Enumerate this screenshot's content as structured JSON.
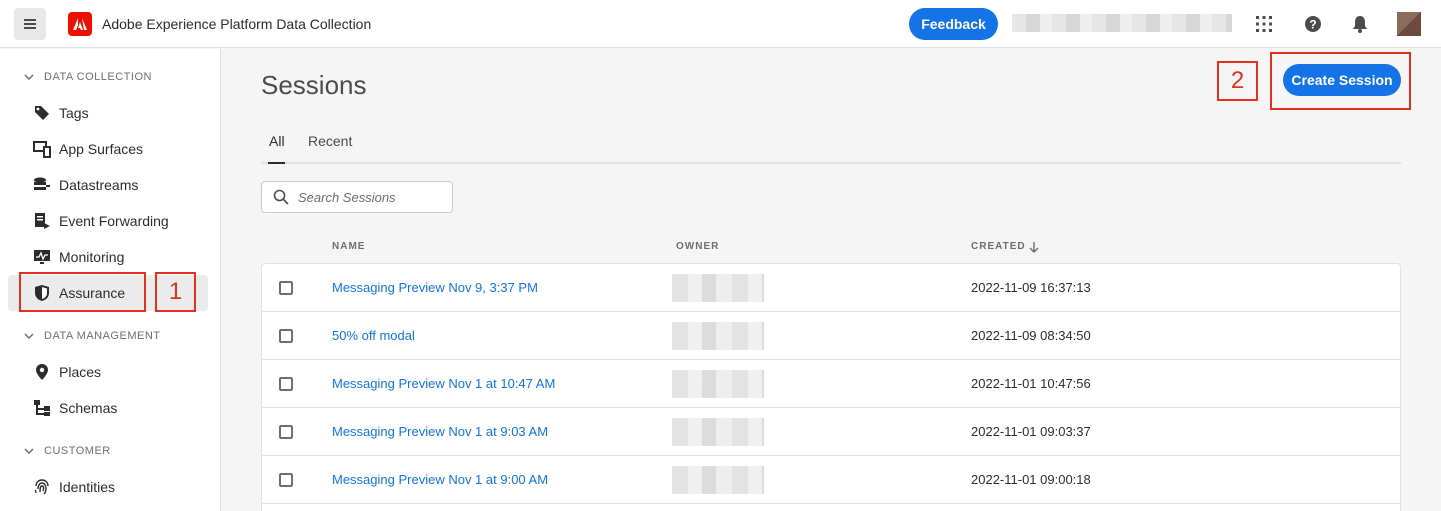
{
  "header": {
    "app_title": "Adobe Experience Platform Data Collection",
    "feedback_label": "Feedback",
    "menu_icon": "hamburger-icon",
    "logo_icon": "adobe-logo",
    "apps_icon": "apps-grid-icon",
    "help_icon": "help-icon",
    "notifications_icon": "bell-icon"
  },
  "sidebar": {
    "sections": [
      {
        "title": "DATA COLLECTION",
        "items": [
          {
            "label": "Tags",
            "icon": "tags-icon"
          },
          {
            "label": "App Surfaces",
            "icon": "app-surfaces-icon"
          },
          {
            "label": "Datastreams",
            "icon": "datastreams-icon"
          },
          {
            "label": "Event Forwarding",
            "icon": "event-forwarding-icon"
          },
          {
            "label": "Monitoring",
            "icon": "monitoring-icon"
          },
          {
            "label": "Assurance",
            "icon": "shield-icon",
            "active": true
          }
        ]
      },
      {
        "title": "DATA MANAGEMENT",
        "items": [
          {
            "label": "Places",
            "icon": "pin-icon"
          },
          {
            "label": "Schemas",
            "icon": "schemas-icon"
          }
        ]
      },
      {
        "title": "CUSTOMER",
        "items": [
          {
            "label": "Identities",
            "icon": "fingerprint-icon"
          }
        ]
      }
    ]
  },
  "annotations": {
    "one": "1",
    "two": "2",
    "color": "#e0321f"
  },
  "main": {
    "title": "Sessions",
    "create_button": "Create Session",
    "tabs": [
      "All",
      "Recent"
    ],
    "search_placeholder": "Search Sessions",
    "columns": [
      "NAME",
      "OWNER",
      "CREATED"
    ],
    "sort_icon": "arrow-down-icon",
    "rows": [
      {
        "name": "Messaging Preview Nov 9, 3:37 PM",
        "created": "2022-11-09 16:37:13"
      },
      {
        "name": "50% off modal",
        "created": "2022-11-09 08:34:50"
      },
      {
        "name": "Messaging Preview Nov 1 at 10:47 AM",
        "created": "2022-11-01 10:47:56"
      },
      {
        "name": "Messaging Preview Nov 1 at 9:03 AM",
        "created": "2022-11-01 09:03:37"
      },
      {
        "name": "Messaging Preview Nov 1 at 9:00 AM",
        "created": "2022-11-01 09:00:18"
      }
    ]
  },
  "colors": {
    "accent": "#1473e6",
    "brand": "#eb1000"
  }
}
